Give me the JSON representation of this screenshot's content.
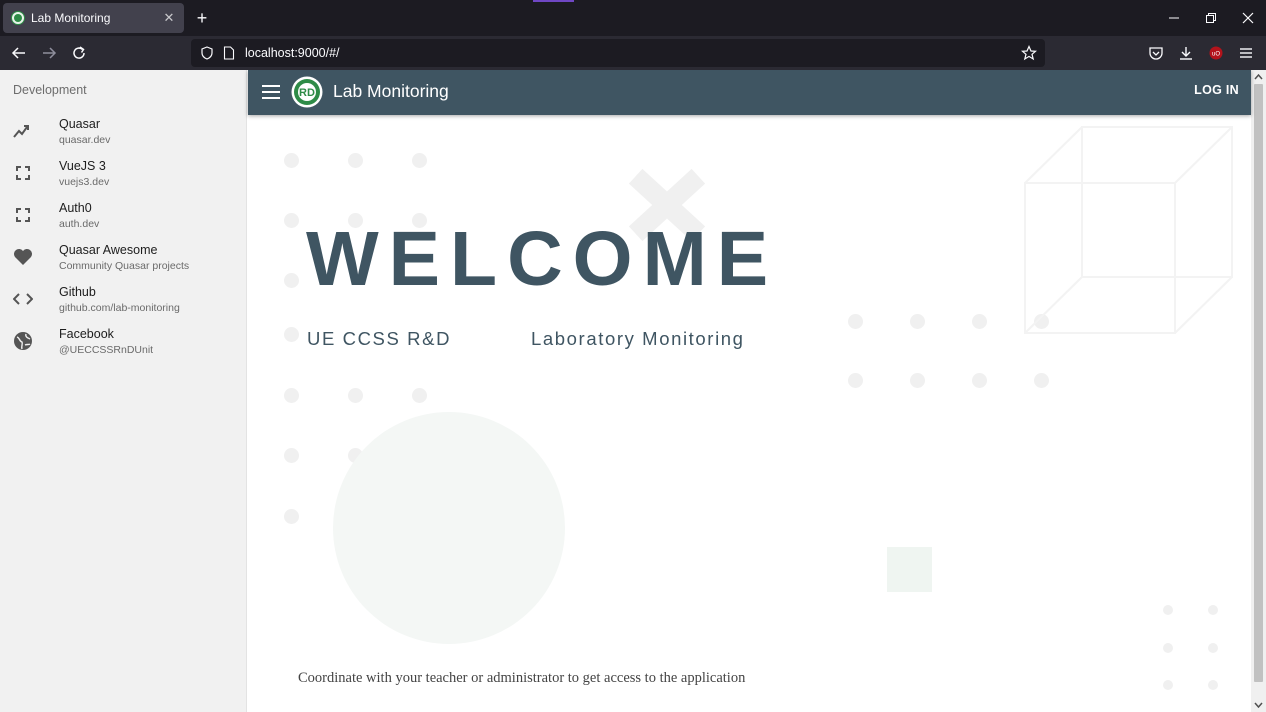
{
  "browser": {
    "tab_title": "Lab Monitoring",
    "tab_close": "✕",
    "new_tab": "+",
    "url": "localhost:9000/#/"
  },
  "drawer": {
    "header": "Development",
    "items": [
      {
        "label": "Quasar",
        "caption": "quasar.dev",
        "icon": "trending-up-icon"
      },
      {
        "label": "VueJS 3",
        "caption": "vuejs3.dev",
        "icon": "fullscreen-icon"
      },
      {
        "label": "Auth0",
        "caption": "auth.dev",
        "icon": "fullscreen-icon"
      },
      {
        "label": "Quasar Awesome",
        "caption": "Community Quasar projects",
        "icon": "heart-icon"
      },
      {
        "label": "Github",
        "caption": "github.com/lab-monitoring",
        "icon": "code-icon"
      },
      {
        "label": "Facebook",
        "caption": "@UECCSSRnDUnit",
        "icon": "globe-icon"
      }
    ]
  },
  "header": {
    "title": "Lab Monitoring",
    "login_label": "LOG IN",
    "color": "#3f5562"
  },
  "hero": {
    "welcome": "WELCOME",
    "sub_left": "UE CCSS R&D",
    "sub_right": "Laboratory Monitoring",
    "note": "Coordinate with your teacher or administrator to get access to the application"
  }
}
